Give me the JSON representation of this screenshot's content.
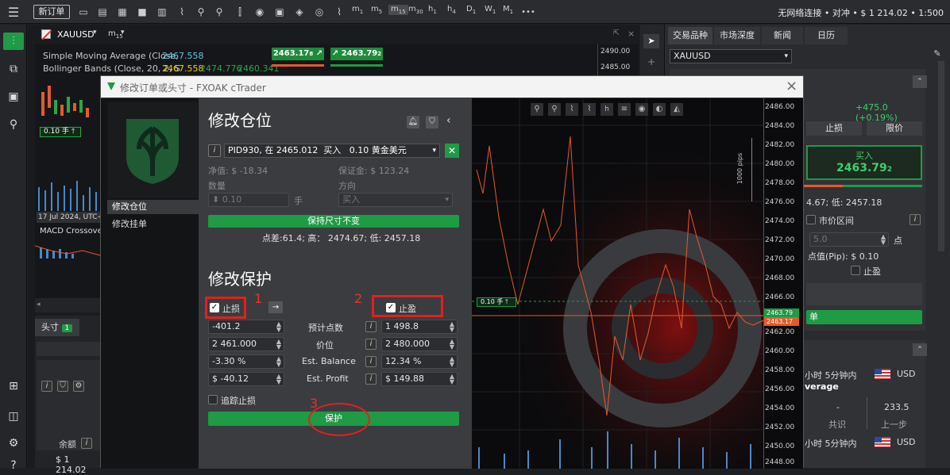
{
  "topbar": {
    "new_order": "新订单",
    "timeframes": [
      {
        "main": "m",
        "sub": "1"
      },
      {
        "main": "m",
        "sub": "5"
      },
      {
        "main": "m",
        "sub": "15"
      },
      {
        "main": "m",
        "sub": "30"
      },
      {
        "main": "h",
        "sub": "1"
      },
      {
        "main": "h",
        "sub": "4"
      },
      {
        "main": "D",
        "sub": "1"
      },
      {
        "main": "W",
        "sub": "1"
      },
      {
        "main": "M",
        "sub": "1"
      }
    ],
    "more": "•••",
    "account_info": "无网络连接 • 对冲 • $ 1 214.02 • 1:500"
  },
  "chart": {
    "symbol": "XAUUSD",
    "timeframe_main": "m",
    "timeframe_sub": "15",
    "sell_price_main": "2463.17",
    "sell_price_sub": "8",
    "buy_price_main": "2463.79",
    "buy_price_sub": "2",
    "sma_label": "Simple Moving Average (Close,",
    "sma_value": "2467.558",
    "bb_label": "Bollinger Bands (Close, 20, 2, S",
    "bb_values": [
      "2467.558",
      "2474.776",
      "2460.341"
    ],
    "axis_top": [
      "2490.00",
      "2485.00"
    ],
    "position_tag": "0.10 手",
    "date_label": "17 Jul 2024, UTC+",
    "macd_label": "MACD Crossove"
  },
  "bottom_left": {
    "tab_label": "头寸",
    "tab_count": "1",
    "balance_label": "余额",
    "balance_value": "$ 1 214.02"
  },
  "right_panel": {
    "tabs": [
      "交易品种",
      "市场深度",
      "新闻",
      "日历"
    ],
    "symbol_select": "XAUUSD",
    "change": "+475.0 (+0.19%)",
    "stop_tab": "止损",
    "limit_tab": "限价",
    "buy_label": "买入",
    "buy_price_main": "2463.79",
    "buy_price_sub": "2",
    "hilo": "4.67; 低: 2457.18",
    "market_range": "市价区间",
    "range_value": "5.0",
    "range_unit": "点",
    "pip_value": "点值(Pip): $ 0.10",
    "take_profit": "止盈",
    "submit_tail": "单",
    "news1_time": "小时 5分钟内",
    "news1_currency": "USD",
    "news1_title": "verage",
    "consensus_val": "-",
    "consensus_lbl": "共识",
    "prev_val": "233.5",
    "prev_lbl": "上一步",
    "news2_time": "小时 5分钟内",
    "news2_currency": "USD"
  },
  "modal": {
    "title": "修改订单或头寸 - FXOAK cTrader",
    "nav": [
      "修改仓位",
      "修改挂单"
    ],
    "section_title": "修改仓位",
    "position_select": "PID930, 在 2465.012  买入   0.10 黄金美元",
    "equity": "净值: $ -18.34",
    "margin": "保证金: $ 123.24",
    "qty_label": "数量",
    "dir_label": "方向",
    "qty_value": "0.10",
    "qty_unit": "手",
    "dir_value": "买入",
    "keep_size": "保持尺寸不变",
    "spread_info": "点差:61.4; 高： 2474.67; 低: 2457.18",
    "protect_title": "修改保护",
    "sl_label": "止损",
    "tp_label": "止盈",
    "rows": [
      {
        "label": "预计点数",
        "sl": "-401.2",
        "tp": "1 498.8"
      },
      {
        "label": "价位",
        "sl": "2 461.000",
        "tp": "2 480.000"
      },
      {
        "label": "Est. Balance",
        "sl": "-3.30 %",
        "tp": "12.34 %"
      },
      {
        "label": "Est. Profit",
        "sl": "$ -40.12",
        "tp": "$ 149.88"
      }
    ],
    "trailing": "追踪止损",
    "protect_btn": "保护",
    "annot": [
      "1",
      "2",
      "3"
    ]
  },
  "modal_chart": {
    "pips_label": "1000 pips",
    "axis": [
      "2486.00",
      "2484.00",
      "2482.00",
      "2480.00",
      "2478.00",
      "2476.00",
      "2474.00",
      "2472.00",
      "2470.00",
      "2468.00",
      "2466.00",
      "2464.00",
      "2462.00",
      "2460.00",
      "2458.00",
      "2456.00",
      "2454.00",
      "2452.00",
      "2450.00",
      "2448.00"
    ],
    "tag_upper": "2463.79",
    "tag_lower": "2463.17",
    "position_tag": "0.10 手"
  },
  "colors": {
    "accent_green": "#1f9a45",
    "sell_red": "#e35b2c",
    "annotation_red": "#e02020"
  }
}
